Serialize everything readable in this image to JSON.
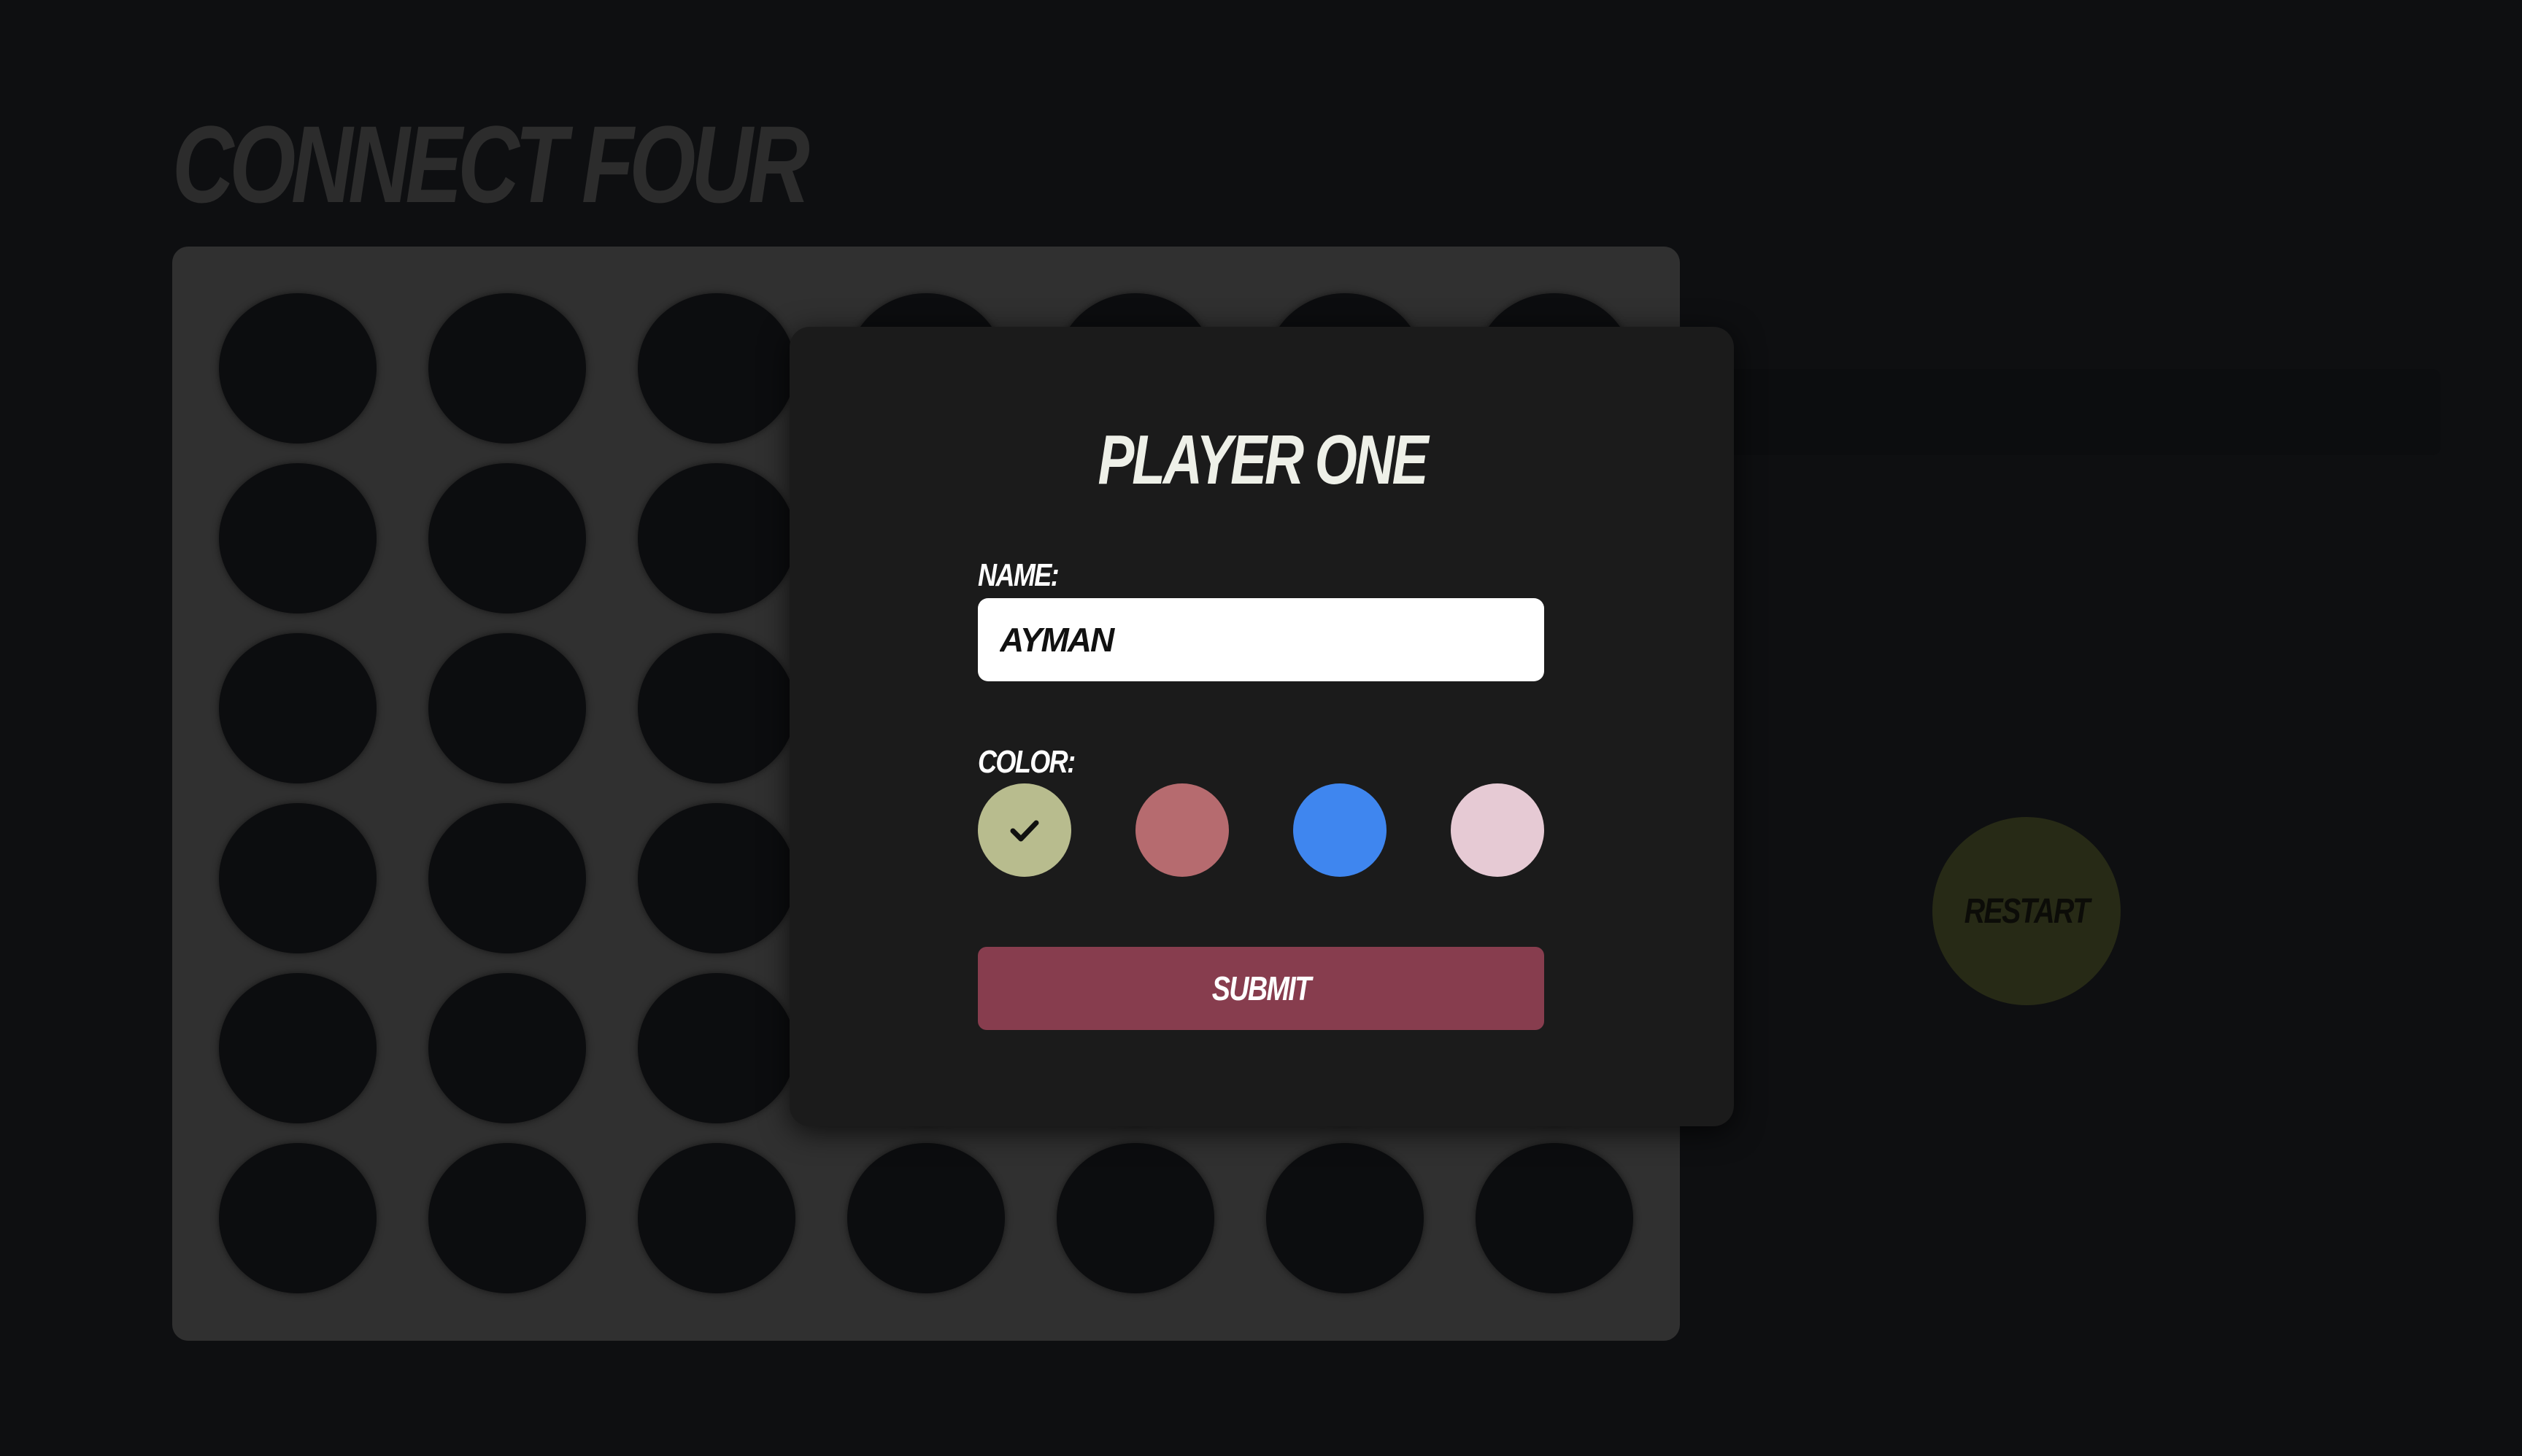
{
  "app": {
    "title": "Connect Four"
  },
  "board": {
    "rows": 6,
    "columns": 7,
    "hole_color": "#0c0d0f",
    "board_color": "#303030"
  },
  "controls": {
    "restart_label": "Restart",
    "restart_color": "#272a16"
  },
  "modal": {
    "title": "Player One",
    "name_label": "Name:",
    "name_value": "AYMAN",
    "color_label": "Color:",
    "colors": [
      {
        "name": "sage",
        "hex": "#b8bc8e",
        "selected": true,
        "icon": "check-icon"
      },
      {
        "name": "rose",
        "hex": "#b66b6f",
        "selected": false
      },
      {
        "name": "blue",
        "hex": "#3f86ef",
        "selected": false
      },
      {
        "name": "pink",
        "hex": "#e6cad4",
        "selected": false
      }
    ],
    "submit_label": "Submit",
    "submit_color": "#873d4e"
  }
}
